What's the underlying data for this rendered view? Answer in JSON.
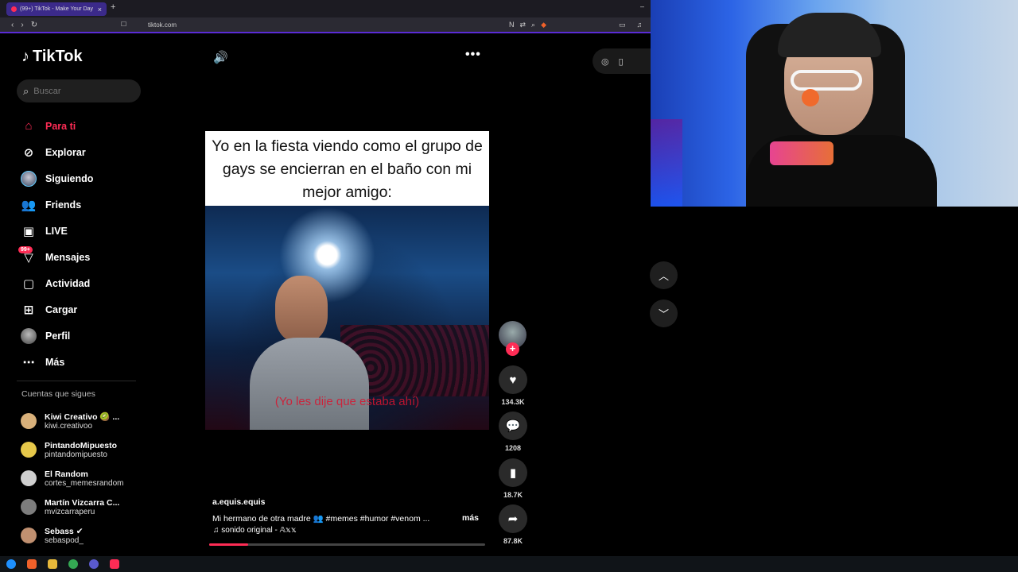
{
  "browser": {
    "tab_title": "(99+) TikTok - Make Your Day",
    "url": "tiktok.com"
  },
  "sidebar": {
    "logo": "TikTok",
    "search_placeholder": "Buscar",
    "items": [
      {
        "label": "Para ti",
        "icon": "home-icon"
      },
      {
        "label": "Explorar",
        "icon": "compass-icon"
      },
      {
        "label": "Siguiendo",
        "icon": "avatar"
      },
      {
        "label": "Friends",
        "icon": "friends-icon"
      },
      {
        "label": "LIVE",
        "icon": "live-icon"
      },
      {
        "label": "Mensajes",
        "icon": "inbox-icon",
        "badge": "99+"
      },
      {
        "label": "Actividad",
        "icon": "activity-icon"
      },
      {
        "label": "Cargar",
        "icon": "upload-icon"
      },
      {
        "label": "Perfil",
        "icon": "avatar"
      },
      {
        "label": "Más",
        "icon": "more-icon"
      }
    ],
    "following_title": "Cuentas que sigues",
    "following": [
      {
        "name": "Kiwi Creativo 🥝 ...",
        "user": "kiwi.creativoo",
        "color": "#d8b07a"
      },
      {
        "name": "PintandoMipuesto",
        "user": "pintandomipuesto",
        "color": "#e6c84a"
      },
      {
        "name": "El Random",
        "user": "cortes_memesrandom",
        "color": "#cfcfcf"
      },
      {
        "name": "Martín Vizcarra C...",
        "user": "mvizcarraperu",
        "color": "#7d7d7d"
      },
      {
        "name": "Sebass ✔",
        "user": "sebaspod_",
        "color": "#c09070"
      }
    ]
  },
  "video": {
    "caption": "Yo en la fiesta viendo como el grupo de gays se encierran en el baño con mi mejor amigo:",
    "subtitle": "(Yo les dije que estaba ahí)",
    "author": "a.equis.equis",
    "description": "Mi hermano de otra madre 👥 #memes #humor #venom ...",
    "more_label": "más",
    "sound": "♫ sonido original - 𝔸𝕩𝕩",
    "progress": 0.14
  },
  "actions": {
    "likes": "134.3K",
    "comments": "1208",
    "saves": "18.7K",
    "shares": "87.8K"
  }
}
